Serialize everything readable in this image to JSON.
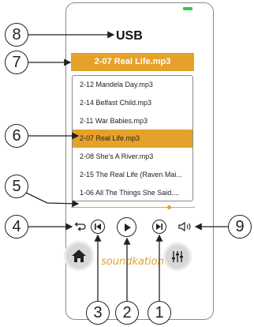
{
  "header": {
    "title": "USB"
  },
  "now_playing": {
    "title": "2-07 Real Life.mp3"
  },
  "tracks": [
    "2-12 Mandela Day.mp3",
    "2-14 Belfast Child.mp3",
    "2-11 War Babies.mp3",
    "2-07 Real Life.mp3",
    "2-08 She's A River.mp3",
    "2-15 The Real Life (Raven Mai...",
    "1-06 All The Things She Said...."
  ],
  "active_track_index": 3,
  "progress": {
    "position_fraction": 0.79
  },
  "controls": {
    "repeat_icon": "repeat-icon",
    "prev_icon": "skip-previous-icon",
    "play_icon": "play-icon",
    "next_icon": "skip-next-icon",
    "volume_icon": "volume-icon",
    "home_icon": "home-icon",
    "equalizer_icon": "equalizer-icon"
  },
  "brand": {
    "text": "soundkation"
  },
  "callouts": {
    "c1": "1",
    "c2": "2",
    "c3": "3",
    "c4": "4",
    "c5": "5",
    "c6": "6",
    "c7": "7",
    "c8": "8",
    "c9": "9"
  },
  "colors": {
    "accent": "#e6a12a",
    "battery": "#2ecc40"
  }
}
